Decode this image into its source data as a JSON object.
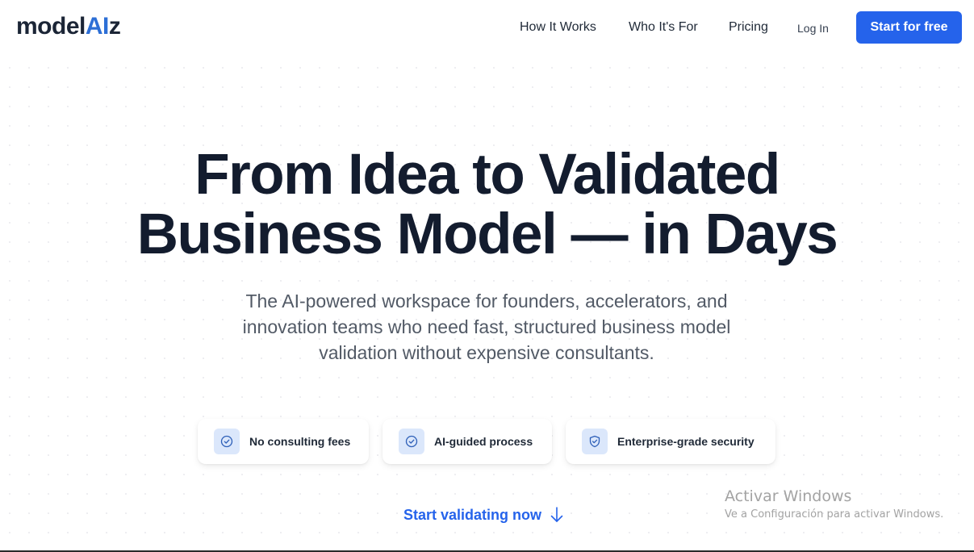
{
  "header": {
    "logo": {
      "prefix": "model",
      "highlight": "AI",
      "suffix": "z"
    },
    "nav": {
      "how_it_works": "How It Works",
      "who_its_for": "Who It's For",
      "pricing": "Pricing",
      "login": "Log In"
    },
    "cta_label": "Start for free"
  },
  "hero": {
    "title_line1": "From Idea to Validated",
    "title_line2": "Business Model — in Days",
    "subtitle": "The AI-powered workspace for founders, accelerators, and innovation teams who need fast, structured business model validation without expensive consultants."
  },
  "badges": [
    {
      "label": "No consulting fees",
      "icon": "check-circle-icon"
    },
    {
      "label": "AI-guided process",
      "icon": "check-circle-icon"
    },
    {
      "label": "Enterprise-grade security",
      "icon": "shield-check-icon"
    }
  ],
  "start_link": {
    "label": "Start validating now",
    "icon": "arrow-down-icon"
  },
  "watermark": {
    "title": "Activar Windows",
    "subtitle": "Ve a Configuración para activar Windows."
  },
  "colors": {
    "accent": "#2563eb",
    "logo_ai": "#2d6fd6",
    "heading": "#131c2e",
    "badge_icon_bg": "#dbe7fb"
  }
}
